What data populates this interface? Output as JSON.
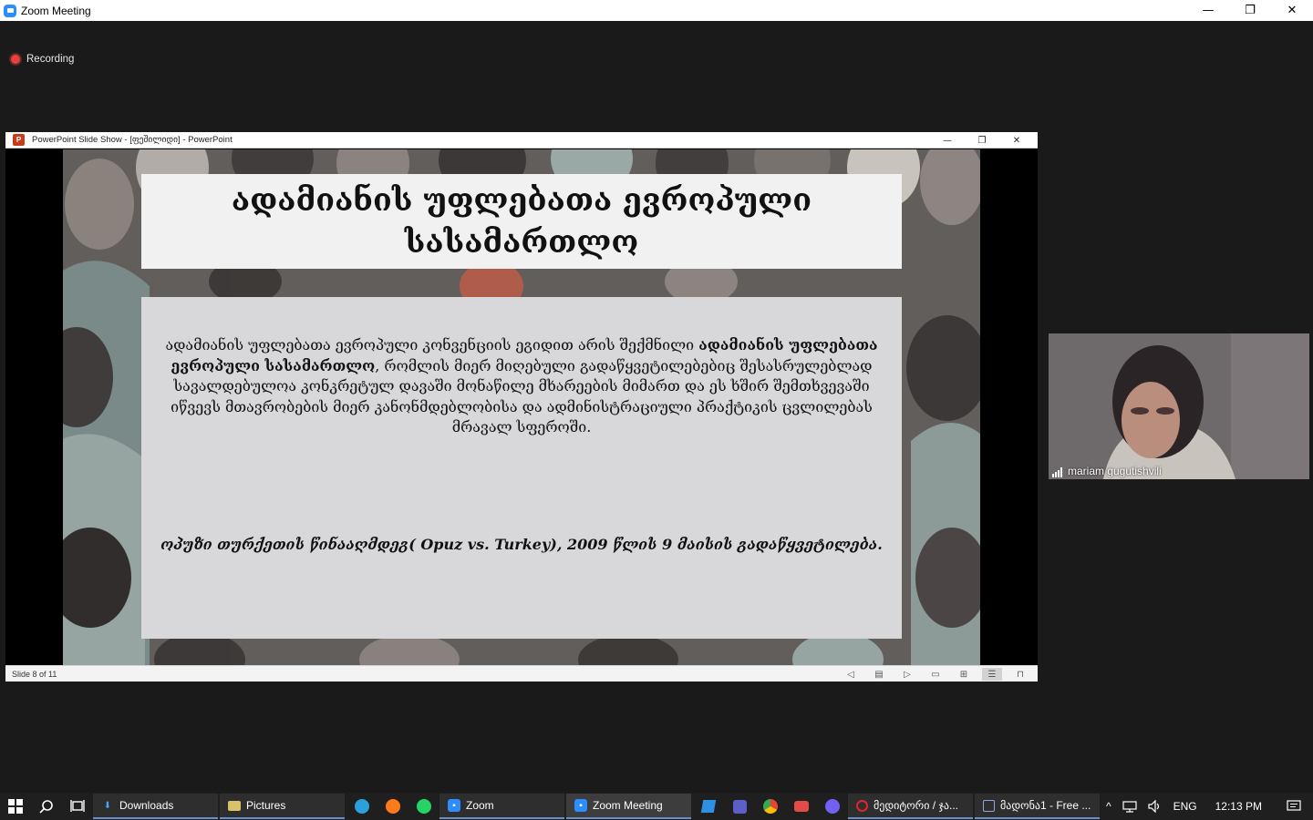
{
  "window": {
    "title": "Zoom Meeting",
    "minimize_glyph": "—",
    "maximize_glyph": "❐",
    "close_glyph": "✕"
  },
  "recording": {
    "label": "Recording"
  },
  "ppt": {
    "window_title": "PowerPoint Slide Show - [ფეშილიდი] - PowerPoint",
    "logo_letter": "P",
    "status_text": "Slide 8 of 11",
    "slide": {
      "title": "ადამიანის უფლებათა ევროპული სასამართლო",
      "body_part1": "ადამიანის უფლებათა ევროპული კონვენციის ეგიდით არის შექმნილი ",
      "body_bold": "ადამიანის უფლებათა ევროპული სასამართლო",
      "body_part2": ", რომლის მიერ მიღებული გადაწყვეტილებებიც შესასრულებლად სავალდებულოა კონკრეტულ დავაში მონაწილე მხარეების მიმართ და ეს ხშირ შემთხვევაში იწვევს მთავრობების მიერ კანონმდებლობისა და ადმინისტრაციული პრაქტიკის ცვლილებას მრავალ სფეროში.",
      "case_line": "ოპუზი თურქეთის წინააღმდეგ( Opuz vs. Turkey), 2009 წლის 9 მაისის გადაწყვეტილება."
    }
  },
  "participant": {
    "name": "mariam gugutishvili"
  },
  "taskbar": {
    "apps": [
      {
        "label": "Downloads",
        "icon": "download-icon",
        "color": "#4aa3ff"
      },
      {
        "label": "Pictures",
        "icon": "folder-icon",
        "color": "#d8c26a"
      },
      {
        "label": "Zoom",
        "icon": "zoom-icon",
        "color": "#2d8cff"
      },
      {
        "label": "Zoom Meeting",
        "icon": "zoom-icon",
        "color": "#2d8cff"
      },
      {
        "label": "მედიტორი / ჯა...",
        "icon": "opera-icon",
        "color": "#e0262b"
      },
      {
        "label": "მადონა1 - Free ...",
        "icon": "document-icon",
        "color": "#8aa8d8"
      }
    ],
    "language": "ENG",
    "time": "12:13 PM"
  },
  "colors": {
    "zoom_blue": "#2d8cff",
    "recording_red": "#e8403a",
    "ppt_orange": "#c43e1c",
    "title_box": "#f1f1f1",
    "body_box": "#d8d7d9"
  }
}
